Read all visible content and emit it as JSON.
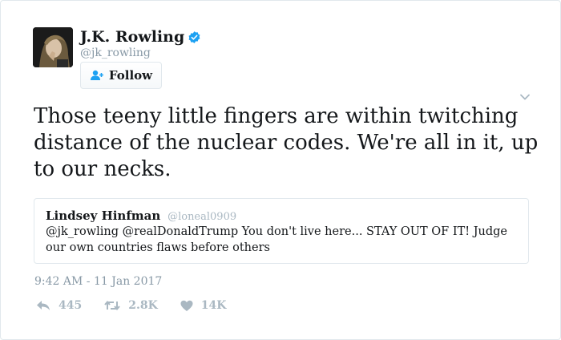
{
  "author": {
    "name": "J.K. Rowling",
    "handle": "@jk_rowling",
    "verified": true
  },
  "follow_button": {
    "label": "Follow",
    "icon": "add-user-icon"
  },
  "tweet": {
    "text": "Those teeny little fingers are within twitching distance of the nuclear codes. We're all in it, up to our necks.",
    "timestamp": "9:42 AM - 11 Jan 2017"
  },
  "quoted_tweet": {
    "author_name": "Lindsey Hinfman",
    "author_handle": "@loneal0909",
    "text": "@jk_rowling @realDonaldTrump You don't live here... STAY OUT OF IT! Judge our own countries flaws before others"
  },
  "actions": {
    "reply": {
      "icon": "reply-icon",
      "count": "445"
    },
    "retweet": {
      "icon": "retweet-icon",
      "count": "2.8K"
    },
    "like": {
      "icon": "heart-icon",
      "count": "14K"
    }
  },
  "colors": {
    "text": "#14171a",
    "secondary": "#8899a6",
    "muted": "#aab8c2",
    "verified": "#1da1f2",
    "border": "#e1e8ed"
  }
}
